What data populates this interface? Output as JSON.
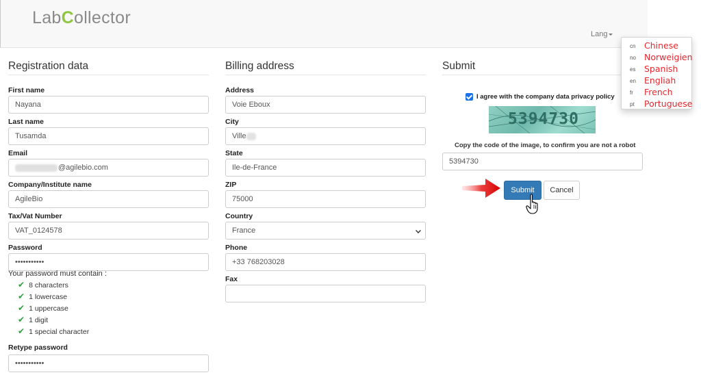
{
  "header": {
    "logo_pre": "Lab",
    "logo_c": "C",
    "logo_post": "ollector",
    "lang_label": "Lang"
  },
  "languages": [
    {
      "code": "cn",
      "name": "Chinese"
    },
    {
      "code": "no",
      "name": "Norweigien"
    },
    {
      "code": "es",
      "name": "Spanish"
    },
    {
      "code": "en",
      "name": "Engliah"
    },
    {
      "code": "fr",
      "name": "French"
    },
    {
      "code": "pt",
      "name": "Portuguese"
    }
  ],
  "registration": {
    "title": "Registration data",
    "first_name_label": "First name",
    "first_name_value": "Nayana",
    "last_name_label": "Last name",
    "last_name_value": "Tusamda",
    "email_label": "Email",
    "email_value": "@agilebio.com",
    "company_label": "Company/Institute name",
    "company_value": "AgileBio",
    "tax_label": "Tax/Vat Number",
    "tax_value": "VAT_0124578",
    "password_label": "Password",
    "password_value": "•••••••••••",
    "pw_hint": "Your password must contain :",
    "requirements": [
      "8 characters",
      "1 lowercase",
      "1 uppercase",
      "1 digit",
      "1 special character"
    ],
    "retype_label": "Retype password",
    "retype_value": "•••••••••••"
  },
  "billing": {
    "title": "Billing address",
    "address_label": "Address",
    "address_value": "Voie Eboux",
    "city_label": "City",
    "city_value": "Ville",
    "state_label": "State",
    "state_value": "Ile-de-France",
    "zip_label": "ZIP",
    "zip_value": "75000",
    "country_label": "Country",
    "country_value": "France",
    "phone_label": "Phone",
    "phone_value": "+33 768203028",
    "fax_label": "Fax",
    "fax_value": ""
  },
  "submit": {
    "title": "Submit",
    "agree_text": "I agree with the company data privacy policy",
    "captcha_text": "5394730",
    "copy_hint": "Copy the code of the image, to confirm you are not a robot",
    "captcha_input_value": "5394730",
    "submit_label": "Submit",
    "cancel_label": "Cancel"
  },
  "colors": {
    "primary": "#337ab7",
    "logo_green": "#8ec63f",
    "menu_red": "#e8262d",
    "check_green": "#2e9f3e"
  }
}
